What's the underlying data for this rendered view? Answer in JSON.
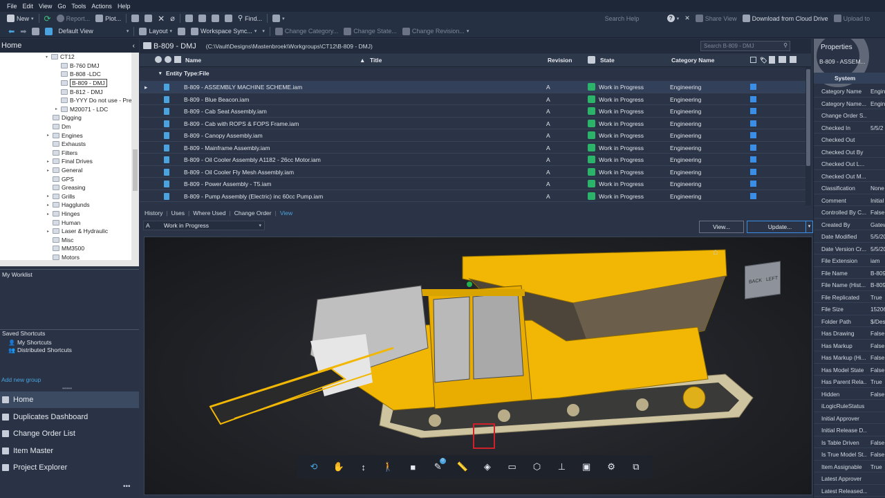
{
  "menu": [
    "File",
    "Edit",
    "View",
    "Go",
    "Tools",
    "Actions",
    "Help"
  ],
  "toolbar1": {
    "new": "New",
    "report": "Report...",
    "plot": "Plot...",
    "find": "Find...",
    "search_help": "Search Help",
    "share_view": "Share View",
    "download_cloud": "Download from Cloud Drive",
    "upload": "Upload to"
  },
  "toolbar2": {
    "default_view": "Default View",
    "layout": "Layout",
    "workspace_sync": "Workspace Sync...",
    "change_category": "Change Category...",
    "change_state": "Change State...",
    "change_revision": "Change Revision..."
  },
  "left": {
    "home": "Home",
    "tree": [
      {
        "label": "CT12",
        "level": 0,
        "expanded": true
      },
      {
        "label": "B-760 DMJ",
        "level": 1
      },
      {
        "label": "B-808 -LDC",
        "level": 1
      },
      {
        "label": "B-809 - DMJ",
        "level": 1,
        "selected": true
      },
      {
        "label": "B-812 - DMJ",
        "level": 1
      },
      {
        "label": "B-YYY Do not use - Pre",
        "level": 1
      },
      {
        "label": "M20071 - LDC",
        "level": 1,
        "expandable": true
      },
      {
        "label": "Digging",
        "level": -1
      },
      {
        "label": "Dm",
        "level": -1
      },
      {
        "label": "Engines",
        "level": -1,
        "expandable": true
      },
      {
        "label": "Exhausts",
        "level": -1
      },
      {
        "label": "Filters",
        "level": -1
      },
      {
        "label": "Final Drives",
        "level": -1,
        "expandable": true
      },
      {
        "label": "General",
        "level": -1,
        "expandable": true
      },
      {
        "label": "GPS",
        "level": -1
      },
      {
        "label": "Greasing",
        "level": -1
      },
      {
        "label": "Grills",
        "level": -1,
        "expandable": true
      },
      {
        "label": "Hagglunds",
        "level": -1,
        "expandable": true
      },
      {
        "label": "Hinges",
        "level": -1,
        "expandable": true
      },
      {
        "label": "Human",
        "level": -1
      },
      {
        "label": "Laser & Hydraulic",
        "level": -1,
        "expandable": true
      },
      {
        "label": "Misc",
        "level": -1
      },
      {
        "label": "MM3500",
        "level": -1
      },
      {
        "label": "Motors",
        "level": -1
      }
    ],
    "worklist": "My Worklist",
    "saved_shortcuts": "Saved Shortcuts",
    "my_shortcuts": "My Shortcuts",
    "distributed_shortcuts": "Distributed Shortcuts",
    "add_group": "Add new group",
    "nav": [
      "Home",
      "Duplicates Dashboard",
      "Change Order List",
      "Item Master",
      "Project Explorer"
    ]
  },
  "main": {
    "title": "B-809 - DMJ",
    "path": "(C:\\Vault\\Designs\\Mastenbroek\\Workgroups\\CT12\\B-809 - DMJ)",
    "search_placeholder": "Search B-809 - DMJ",
    "columns": {
      "name": "Name",
      "title": "Title",
      "revision": "Revision",
      "state": "State",
      "category": "Category Name"
    },
    "group": "Entity Type:File",
    "rows": [
      {
        "name": "B-809 - ASSEMBLY MACHINE SCHEME.iam",
        "revision": "A",
        "state": "Work in Progress",
        "category": "Engineering"
      },
      {
        "name": "B-809 - Blue Beacon.iam",
        "revision": "A",
        "state": "Work in Progress",
        "category": "Engineering"
      },
      {
        "name": "B-809 - Cab Seat Assembly.iam",
        "revision": "A",
        "state": "Work in Progress",
        "category": "Engineering"
      },
      {
        "name": "B-809 - Cab with ROPS & FOPS Frame.iam",
        "revision": "A",
        "state": "Work in Progress",
        "category": "Engineering"
      },
      {
        "name": "B-809 - Canopy Assembly.iam",
        "revision": "A",
        "state": "Work in Progress",
        "category": "Engineering"
      },
      {
        "name": "B-809 - Mainframe Assembly.iam",
        "revision": "A",
        "state": "Work in Progress",
        "category": "Engineering"
      },
      {
        "name": "B-809 - Oil Cooler Assembly A1182 - 26cc Motor.iam",
        "revision": "A",
        "state": "Work in Progress",
        "category": "Engineering"
      },
      {
        "name": "B-809 - Oil Cooler Fly Mesh Assembly.iam",
        "revision": "A",
        "state": "Work in Progress",
        "category": "Engineering"
      },
      {
        "name": "B-809 - Power Assembly - T5.iam",
        "revision": "A",
        "state": "Work in Progress",
        "category": "Engineering"
      },
      {
        "name": "B-809 - Pump Assembly (Electric)  inc 60cc Pump.iam",
        "revision": "A",
        "state": "Work in Progress",
        "category": "Engineering"
      }
    ],
    "tabs": [
      "History",
      "Uses",
      "Where Used",
      "Change Order",
      "View"
    ],
    "active_tab": "View",
    "rev_letter": "A",
    "rev_state": "Work in Progress",
    "view_btn": "View...",
    "update_btn": "Update...",
    "cube_back": "BACK",
    "cube_left": "LEFT",
    "badge_count": "0"
  },
  "props": {
    "title": "Properties",
    "selector": "B-809 - ASSEM...",
    "section": "System",
    "rows": [
      {
        "k": "Category Name",
        "v": "Engin"
      },
      {
        "k": "Category Name...",
        "v": "Engin"
      },
      {
        "k": "Change Order S...",
        "v": ""
      },
      {
        "k": "Checked In",
        "v": "5/5/2"
      },
      {
        "k": "Checked Out",
        "v": ""
      },
      {
        "k": "Checked Out By",
        "v": ""
      },
      {
        "k": "Checked Out L...",
        "v": ""
      },
      {
        "k": "Checked Out M...",
        "v": ""
      },
      {
        "k": "Classification",
        "v": "None"
      },
      {
        "k": "Comment",
        "v": "Initial"
      },
      {
        "k": "Controlled By C...",
        "v": "False"
      },
      {
        "k": "Created By",
        "v": "Gatew"
      },
      {
        "k": "Date Modified",
        "v": "5/5/20"
      },
      {
        "k": "Date Version Cr...",
        "v": "5/5/20"
      },
      {
        "k": "File Extension",
        "v": "iam"
      },
      {
        "k": "File Name",
        "v": "B-809"
      },
      {
        "k": "File Name (Hist...",
        "v": "B-809"
      },
      {
        "k": "File Replicated",
        "v": "True"
      },
      {
        "k": "File Size",
        "v": "15206"
      },
      {
        "k": "Folder Path",
        "v": "$/Des"
      },
      {
        "k": "Has Drawing",
        "v": "False"
      },
      {
        "k": "Has Markup",
        "v": "False"
      },
      {
        "k": "Has Markup (Hi...",
        "v": "False"
      },
      {
        "k": "Has Model State",
        "v": "False"
      },
      {
        "k": "Has Parent Rela...",
        "v": "True"
      },
      {
        "k": "Hidden",
        "v": "False"
      },
      {
        "k": "iLogicRuleStatus",
        "v": ""
      },
      {
        "k": "Initial Approver",
        "v": ""
      },
      {
        "k": "Initial Release D...",
        "v": ""
      },
      {
        "k": "Is Table Driven",
        "v": "False"
      },
      {
        "k": "Is True Model St...",
        "v": "False"
      },
      {
        "k": "Item Assignable",
        "v": "True"
      },
      {
        "k": "Latest Approver",
        "v": ""
      },
      {
        "k": "Latest Released...",
        "v": ""
      }
    ]
  },
  "colors": {
    "accent": "#4aa3df",
    "state_green": "#2bb36a",
    "machine_yellow": "#f2b705"
  }
}
